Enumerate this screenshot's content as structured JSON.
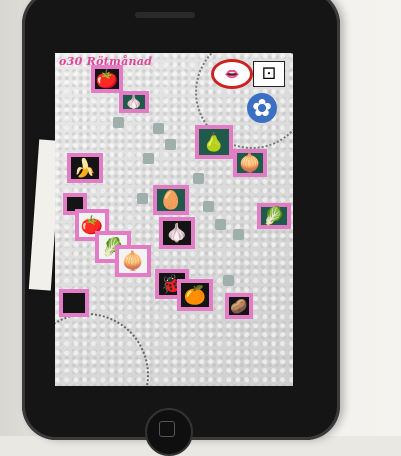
{
  "app": {
    "title": "o30 Rötmånad"
  },
  "colors": {
    "title": "#e0459b",
    "tile_border": "#e27cc4",
    "tile_dark": "#1f5a4a"
  },
  "icons": {
    "tomato": "🍅",
    "garlic": "🧄",
    "banana": "🍌",
    "pear": "🍐",
    "egg": "🥚",
    "onion": "🧅",
    "orange": "🍊",
    "potatoes": "🥔",
    "cabbage": "🥬",
    "bug": "🐞",
    "flower": "✿",
    "mouth": "👄",
    "card": "⚀"
  }
}
